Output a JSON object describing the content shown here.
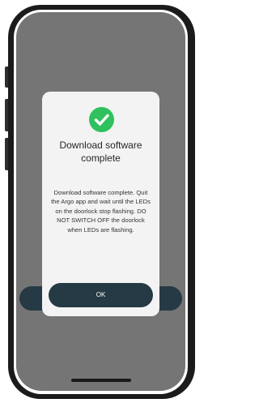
{
  "dialog": {
    "status_icon": "check-circle-icon",
    "title": "Download software complete",
    "message": "Download software complete. Quit the Argo app and wait until the LEDs on the doorlock stop flashing. DO NOT SWITCH OFF the doorlock when LEDs are flashing.",
    "ok_label": "OK"
  },
  "colors": {
    "success": "#2ec15e",
    "primary_button": "#253a44",
    "overlay": "#757575",
    "dialog_background": "#f3f3f3"
  }
}
